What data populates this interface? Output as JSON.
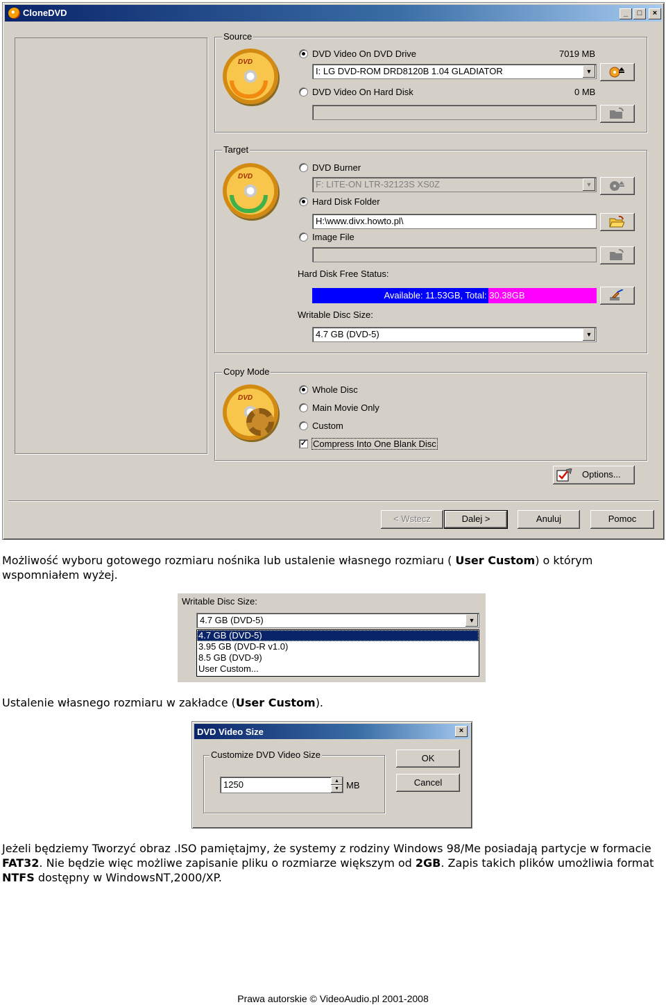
{
  "window": {
    "title": "CloneDVD",
    "buttons": {
      "minimize": "_",
      "maximize": "□",
      "close": "×"
    }
  },
  "source": {
    "label": "Source",
    "dvd_drive": {
      "label": "DVD Video On DVD Drive",
      "size": "7019 MB",
      "selected": true,
      "device": "I: LG      DVD-ROM DRD8120B 1.04 GLADIATOR"
    },
    "hard_disk": {
      "label": "DVD Video On Hard Disk",
      "size": "0 MB",
      "selected": false,
      "path": ""
    }
  },
  "target": {
    "label": "Target",
    "dvd_burner": {
      "label": "DVD Burner",
      "selected": false,
      "device": "F: LITE-ON  LTR-32123S      XS0Z"
    },
    "hard_disk_folder": {
      "label": "Hard Disk Folder",
      "selected": true,
      "path": "H:\\www.divx.howto.pl\\"
    },
    "image_file": {
      "label": "Image File",
      "selected": false,
      "path": ""
    },
    "free_status": {
      "label": "Hard Disk Free Status:",
      "available_text": "Available: 11.53GB, Total: ",
      "total_text": "30.38GB",
      "available_gb": 11.53,
      "total_gb": 30.38
    },
    "writable_size": {
      "label": "Writable Disc Size:",
      "value": "4.7 GB (DVD-5)"
    }
  },
  "copy_mode": {
    "label": "Copy Mode",
    "whole_disc": {
      "label": "Whole Disc",
      "selected": true
    },
    "main_movie": {
      "label": "Main Movie Only",
      "selected": false
    },
    "custom": {
      "label": "Custom",
      "selected": false
    },
    "compress": {
      "label": "Compress Into One Blank Disc",
      "checked": true,
      "check_glyph": "✓"
    }
  },
  "options_button": "Options...",
  "nav": {
    "back": "< Wstecz",
    "next": "Dalej >",
    "cancel": "Anuluj",
    "help": "Pomoc"
  },
  "icons": {
    "dropdown": "▼",
    "spin_up": "▲",
    "spin_down": "▼",
    "dvd_mark": "DVD"
  },
  "text": {
    "p1_a": "Możliwość wyboru gotowego rozmiaru nośnika lub ustalenie własnego rozmiaru ( ",
    "p1_b": "User Custom",
    "p1_c": ") o którym wspomniałem wyżej.",
    "p2_a": "Ustalenie własnego rozmiaru w zakładce (",
    "p2_b": "User Custom",
    "p2_c": ").",
    "p3_a": "Jeżeli będziemy Tworzyć obraz .ISO pamiętajmy, że systemy z rodziny Windows 98/Me posiadają partycje w formacie ",
    "p3_b": "FAT32",
    "p3_c": ". Nie będzie więc możliwe zapisanie pliku o rozmiarze większym od  ",
    "p3_d": "2GB",
    "p3_e": ". Zapis takich plików umożliwia format  ",
    "p3_f": "NTFS",
    "p3_g": " dostępny w WindowsNT,2000/XP."
  },
  "excerpt_dropdown": {
    "label": "Writable Disc Size:",
    "value": "4.7 GB (DVD-5)",
    "options": [
      "4.7 GB (DVD-5)",
      "3.95 GB (DVD-R v1.0)",
      "8.5 GB (DVD-9)",
      "User Custom..."
    ],
    "selected_index": 0
  },
  "excerpt_dialog": {
    "title": "DVD Video Size",
    "group": "Customize DVD Video Size",
    "value": "1250",
    "unit": "MB",
    "ok": "OK",
    "cancel": "Cancel",
    "close": "×"
  },
  "footer": "Prawa autorskie © VideoAudio.pl 2001-2008",
  "colors": {
    "face": "#d4d0c8",
    "title_start": "#0a246a",
    "title_end": "#a6caf0",
    "available": "#0000ff",
    "total": "#ff00ff"
  }
}
